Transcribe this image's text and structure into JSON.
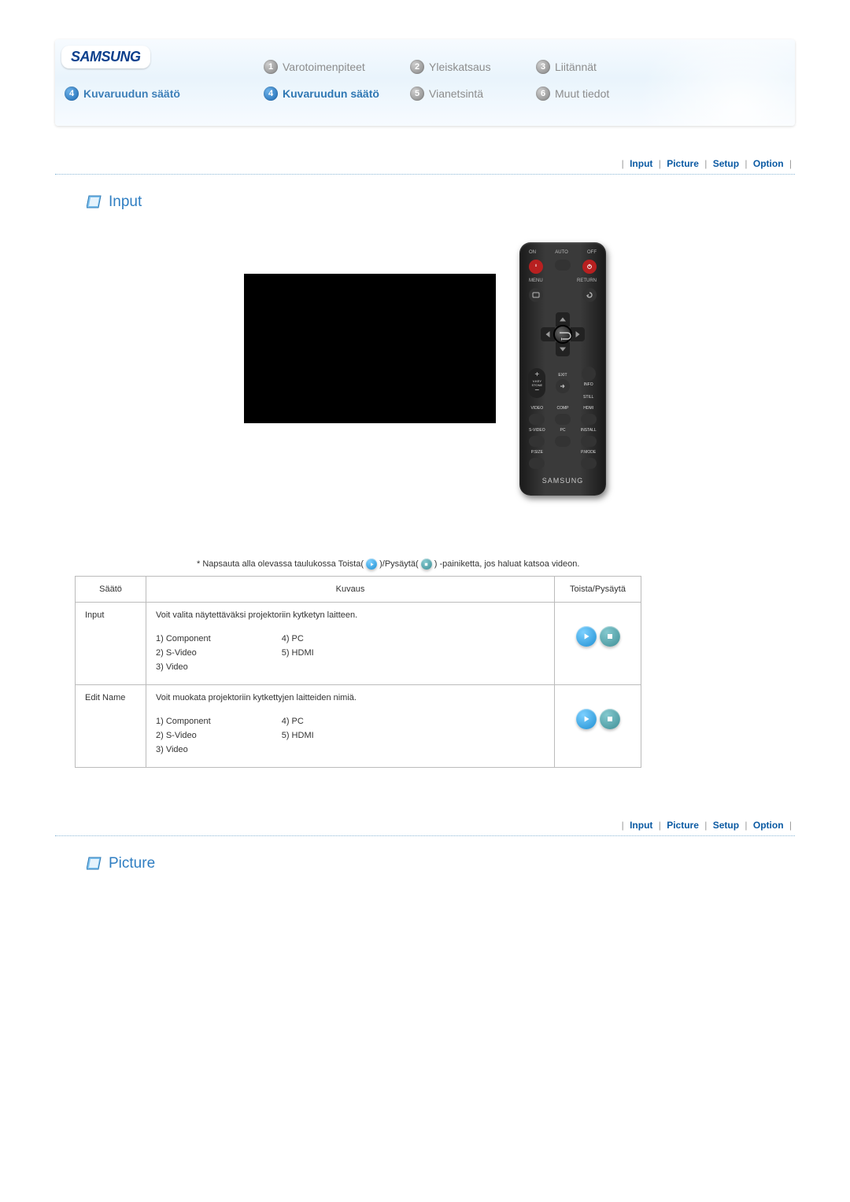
{
  "brand": "SAMSUNG",
  "banner": {
    "left_label": "Kuvaruudun säätö",
    "left_num": "4",
    "items": [
      {
        "num": "1",
        "label": "Varotoimenpiteet",
        "active": false
      },
      {
        "num": "2",
        "label": "Yleiskatsaus",
        "active": false
      },
      {
        "num": "3",
        "label": "Liitännät",
        "active": false
      },
      {
        "num": "4",
        "label": "Kuvaruudun säätö",
        "active": true
      },
      {
        "num": "5",
        "label": "Vianetsintä",
        "active": false
      },
      {
        "num": "6",
        "label": "Muut tiedot",
        "active": false
      }
    ]
  },
  "tabs": [
    {
      "label": "Input"
    },
    {
      "label": "Picture"
    },
    {
      "label": "Setup"
    },
    {
      "label": "Option"
    }
  ],
  "section1_heading": "Input",
  "section2_heading": "Picture",
  "note": {
    "prefix": "* Napsauta alla olevassa taulukossa Toista(",
    "mid": ")/Pysäytä(",
    "suffix": ") -painiketta, jos haluat katsoa videon."
  },
  "table": {
    "head": {
      "a": "Säätö",
      "b": "Kuvaus",
      "c": "Toista/Pysäytä"
    },
    "rows": [
      {
        "name": "Input",
        "desc": "Voit valita näytettäväksi projektoriin kytketyn laitteen.",
        "list_left": [
          "1) Component",
          "2) S-Video",
          "3) Video"
        ],
        "list_right": [
          "4) PC",
          "5) HDMI"
        ]
      },
      {
        "name": "Edit Name",
        "desc": "Voit muokata projektoriin kytkettyjen laitteiden nimiä.",
        "list_left": [
          "1) Component",
          "2) S-Video",
          "3) Video"
        ],
        "list_right": [
          "4) PC",
          "5) HDMI"
        ]
      }
    ]
  },
  "remote": {
    "labels": {
      "on": "ON",
      "auto": "AUTO",
      "off": "OFF",
      "menu": "MENU",
      "return": "RETURN",
      "vkey": "V.KEY\nSTONE",
      "exit": "EXIT",
      "info": "INFO",
      "still": "STILL",
      "video": "VIDEO",
      "comp": "COMP",
      "hdmi": "HDMI",
      "svideo": "S-VIDEO",
      "pc": "PC",
      "install": "INSTALL",
      "psize": "P.SIZE",
      "pmode": "P.MODE"
    },
    "brand": "SAMSUNG"
  }
}
